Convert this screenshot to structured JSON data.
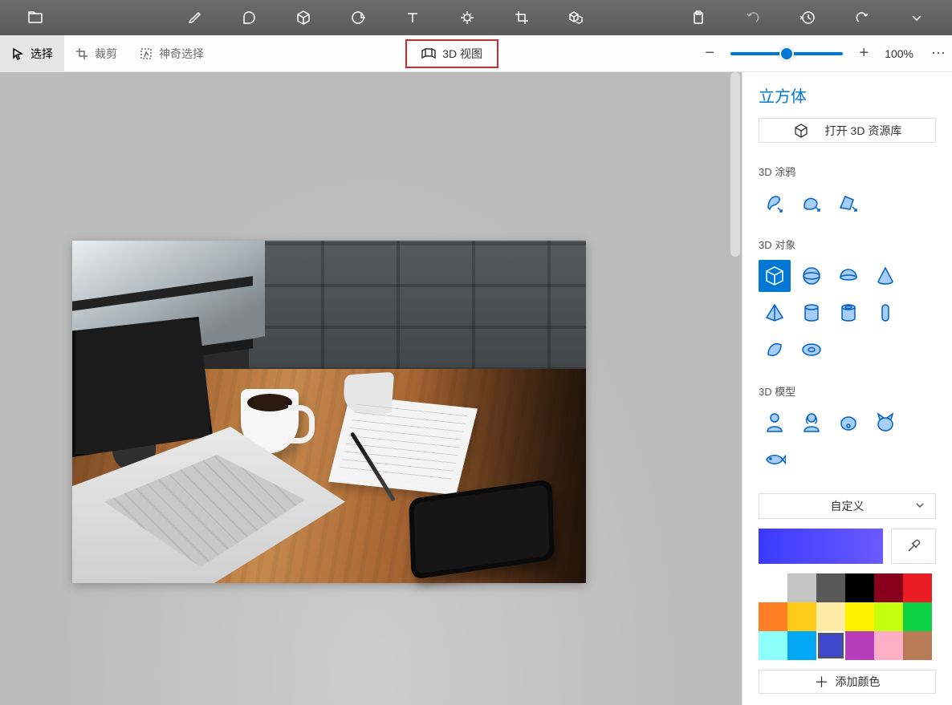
{
  "topTools": [
    "folder",
    "brush",
    "shape2d",
    "shape3d",
    "sticker",
    "text",
    "effects",
    "crop",
    "library"
  ],
  "topRight": [
    "paste",
    "undo",
    "history",
    "redo",
    "expand"
  ],
  "subToolbar": {
    "select": "选择",
    "crop": "裁剪",
    "magic": "神奇选择",
    "view3d": "3D 视图",
    "zoom": "100%"
  },
  "panel": {
    "title": "立方体",
    "openLib": "打开 3D 资源库",
    "sec1": "3D 涂鸦",
    "sec2": "3D 对象",
    "sec3": "3D 模型",
    "custom": "自定义",
    "addColor": "添加颜色"
  },
  "doodles": [
    "tube",
    "soft",
    "sharp"
  ],
  "objects": [
    "cube",
    "sphere",
    "hemisphere",
    "cone",
    "pyramid",
    "cylinder",
    "tube-open",
    "capsule",
    "curved",
    "donut"
  ],
  "models": [
    "man",
    "woman",
    "dog",
    "cat",
    "fish"
  ],
  "palette": [
    "#ffffff",
    "#c3c3c3",
    "#585858",
    "#000000",
    "#88001b",
    "#ec1c24",
    "#ff7f27",
    "#ffca18",
    "#fdeca6",
    "#fff200",
    "#c4ff0e",
    "#0ed145",
    "#8cfffb",
    "#00a8f3",
    "#3f48cc",
    "#b83dba",
    "#ffaec8",
    "#b97a56"
  ],
  "selectedPaletteIdx": 14
}
